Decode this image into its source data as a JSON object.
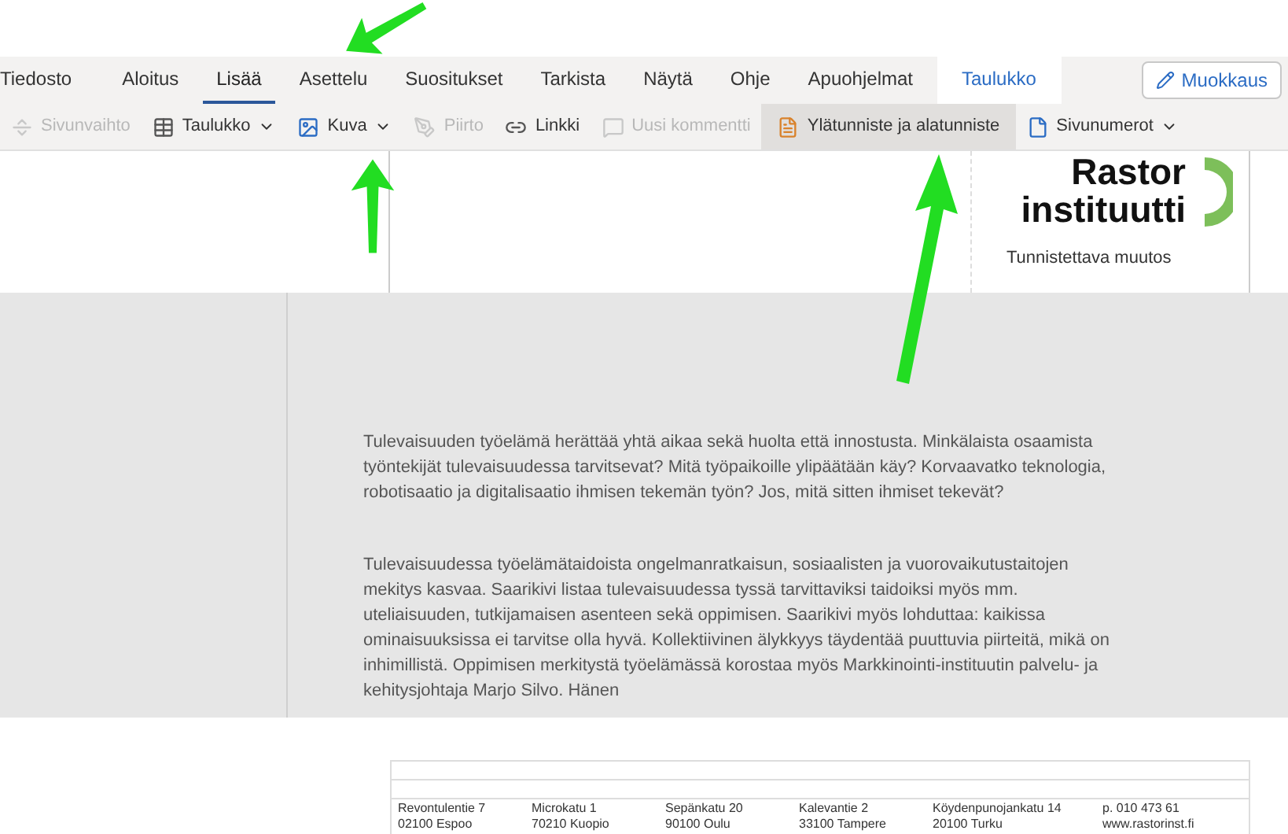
{
  "ribbon_tabs": [
    {
      "label": "Tiedosto",
      "selected": false,
      "kind": "plain"
    },
    {
      "label": "Aloitus",
      "selected": false,
      "kind": "plain"
    },
    {
      "label": "Lisää",
      "selected": true,
      "kind": "plain"
    },
    {
      "label": "Asettelu",
      "selected": false,
      "kind": "plain"
    },
    {
      "label": "Suositukset",
      "selected": false,
      "kind": "plain"
    },
    {
      "label": "Tarkista",
      "selected": false,
      "kind": "plain"
    },
    {
      "label": "Näytä",
      "selected": false,
      "kind": "plain"
    },
    {
      "label": "Ohje",
      "selected": false,
      "kind": "plain"
    },
    {
      "label": "Apuohjelmat",
      "selected": false,
      "kind": "plain"
    },
    {
      "label": "Taulukko",
      "selected": false,
      "kind": "context"
    }
  ],
  "edit_button": {
    "label": "Muokkaus"
  },
  "toolbar": [
    {
      "label": "Sivunvaihto",
      "disabled": true,
      "dropdown": false,
      "selected": false
    },
    {
      "label": "Taulukko",
      "disabled": false,
      "dropdown": true,
      "selected": false
    },
    {
      "label": "Kuva",
      "disabled": false,
      "dropdown": true,
      "selected": false
    },
    {
      "label": "Piirto",
      "disabled": true,
      "dropdown": false,
      "selected": false
    },
    {
      "label": "Linkki",
      "disabled": false,
      "dropdown": false,
      "selected": false
    },
    {
      "label": "Uusi kommentti",
      "disabled": true,
      "dropdown": false,
      "selected": false
    },
    {
      "label": "Ylätunniste ja alatunniste",
      "disabled": false,
      "dropdown": false,
      "selected": true
    },
    {
      "label": "Sivunumerot",
      "disabled": false,
      "dropdown": true,
      "selected": false
    }
  ],
  "header_logo": {
    "line_1": "Rastor",
    "line_2": "instituutti",
    "tagline": "Tunnistettava muutos"
  },
  "paragraphs": [
    "Tulevaisuuden työelämä herättää yhtä aikaa sekä huolta että innostusta. Minkälaista osaamista työntekijät tulevaisuudessa tarvitsevat? Mitä työpaikoille ylipäätään käy? Korvaavatko teknologia, robotisaatio ja digitalisaatio ihmisen tekemän työn? Jos, mitä sitten ihmiset tekevät?",
    "Tulevaisuudessa työelämätaidoista ongelmanratkaisun, sosiaalisten ja vuorovaikutustaitojen mekitys kasvaa. Saarikivi listaa tulevaisuudessa tyssä tarvittaviksi taidoiksi myös mm. uteliaisuuden, tutkijamaisen asenteen sekä oppimisen. Saarikivi myös lohduttaa: kaikissa ominaisuuksissa ei tarvitse olla hyvä. Kollektiivinen älykkyys täydentää puuttuvia piirteitä, mikä on inhimillistä. Oppimisen merkitystä työelämässä korostaa myös Markkinointi-instituutin palvelu- ja kehitysjohtaja Marjo Silvo. Hänen"
  ],
  "footer_addresses": [
    {
      "line_1": "Revontulentie 7",
      "line_2": "02100 Espoo"
    },
    {
      "line_1": "Microkatu 1",
      "line_2": "70210 Kuopio"
    },
    {
      "line_1": "Sepänkatu 20",
      "line_2": "90100 Oulu"
    },
    {
      "line_1": "Kalevantie 2",
      "line_2": "33100 Tampere"
    },
    {
      "line_1": "Köydenpunojankatu 14",
      "line_2": "20100 Turku"
    },
    {
      "line_1": "p. 010 473 61",
      "line_2": "www.rastorinst.fi"
    }
  ]
}
